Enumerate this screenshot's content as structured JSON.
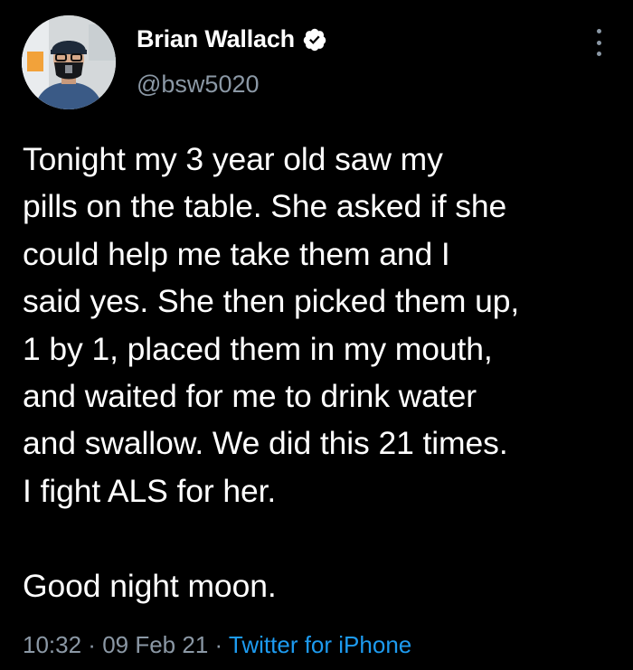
{
  "author": {
    "display_name": "Brian Wallach",
    "handle": "@bsw5020",
    "verified": true
  },
  "tweet": {
    "text": "Tonight my 3 year old saw my\npills on the table. She asked if she\ncould help me take them and I\nsaid yes. She then picked them up,\n1 by 1, placed them in my mouth,\nand waited for me to drink water\nand swallow. We did this 21 times.\nI fight ALS for her.\n\nGood night moon.",
    "time": "10:32",
    "separator": " · ",
    "date": "09 Feb 21",
    "source": "Twitter for iPhone"
  },
  "icons": {
    "verified": "verified-badge-icon",
    "more": "more-vertical-icon"
  },
  "colors": {
    "background": "#000000",
    "text": "#ffffff",
    "secondary": "#8b98a5",
    "link": "#1d9bf0"
  }
}
